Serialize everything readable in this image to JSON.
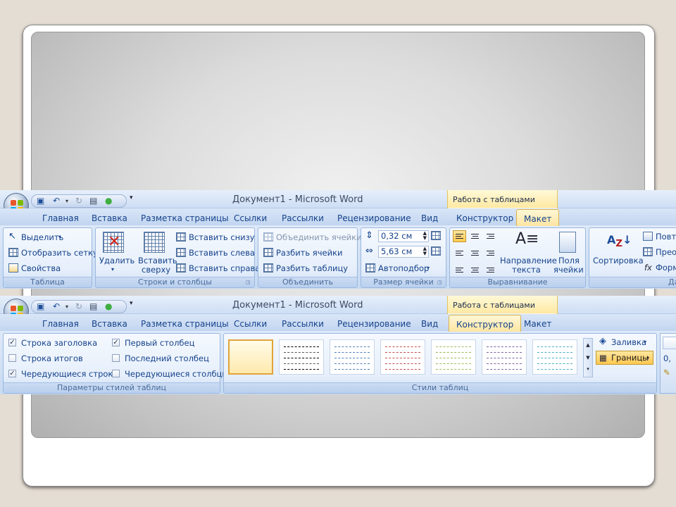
{
  "app": {
    "title": "Документ1 - Microsoft Word",
    "context_label": "Работа с таблицами"
  },
  "qat": {
    "more_symbol": "▾"
  },
  "tabs": [
    "Главная",
    "Вставка",
    "Разметка страницы",
    "Ссылки",
    "Рассылки",
    "Рецензирование",
    "Вид",
    "Конструктор",
    "Макет"
  ],
  "layout_ribbon": {
    "active_tab": "Макет",
    "groups": {
      "table": {
        "title": "Таблица",
        "select": "Выделить",
        "show_grid": "Отобразить сетку",
        "properties": "Свойства"
      },
      "rows_cols": {
        "title": "Строки и столбцы",
        "delete": "Удалить",
        "insert_above_1": "Вставить",
        "insert_above_2": "сверху",
        "insert_below": "Вставить снизу",
        "insert_left": "Вставить слева",
        "insert_right": "Вставить справа"
      },
      "merge": {
        "title": "Объединить",
        "merge_cells": "Объединить ячейки",
        "split_cells": "Разбить ячейки",
        "split_table": "Разбить таблицу"
      },
      "cell_size": {
        "title": "Размер ячейки",
        "height": "0,32 см",
        "width": "5,63 см",
        "autofit": "Автоподбор"
      },
      "alignment": {
        "title": "Выравнивание",
        "text_direction_1": "Направление",
        "text_direction_2": "текста",
        "margins_1": "Поля",
        "margins_2": "ячейки"
      },
      "data": {
        "title": "Да",
        "sort": "Сортировка",
        "repeat": "Повто",
        "convert": "Преоб",
        "formula": "Форм"
      }
    }
  },
  "design_ribbon": {
    "active_tab": "Конструктор",
    "groups": {
      "style_options": {
        "title": "Параметры стилей таблиц",
        "header_row": {
          "label": "Строка заголовка",
          "checked": true
        },
        "total_row": {
          "label": "Строка итогов",
          "checked": false
        },
        "banded_rows": {
          "label": "Чередующиеся строки",
          "checked": true
        },
        "first_column": {
          "label": "Первый столбец",
          "checked": true
        },
        "last_column": {
          "label": "Последний столбец",
          "checked": false
        },
        "banded_columns": {
          "label": "Чередующиеся столбцы",
          "checked": false
        }
      },
      "table_styles": {
        "title": "Стили таблиц",
        "shading": "Заливка",
        "borders": "Границы",
        "partial": "0,",
        "style_colors": [
          "#000000",
          "#333333",
          "#4f81bd",
          "#c0504d",
          "#9bbb59",
          "#8064a2",
          "#4bacc6"
        ]
      }
    }
  },
  "colors": {
    "accent": "#15428b",
    "active_tab_top": "#fff7d6",
    "active_tab_bottom": "#fde5a3",
    "ribbon_bg": "#dee9f8"
  }
}
